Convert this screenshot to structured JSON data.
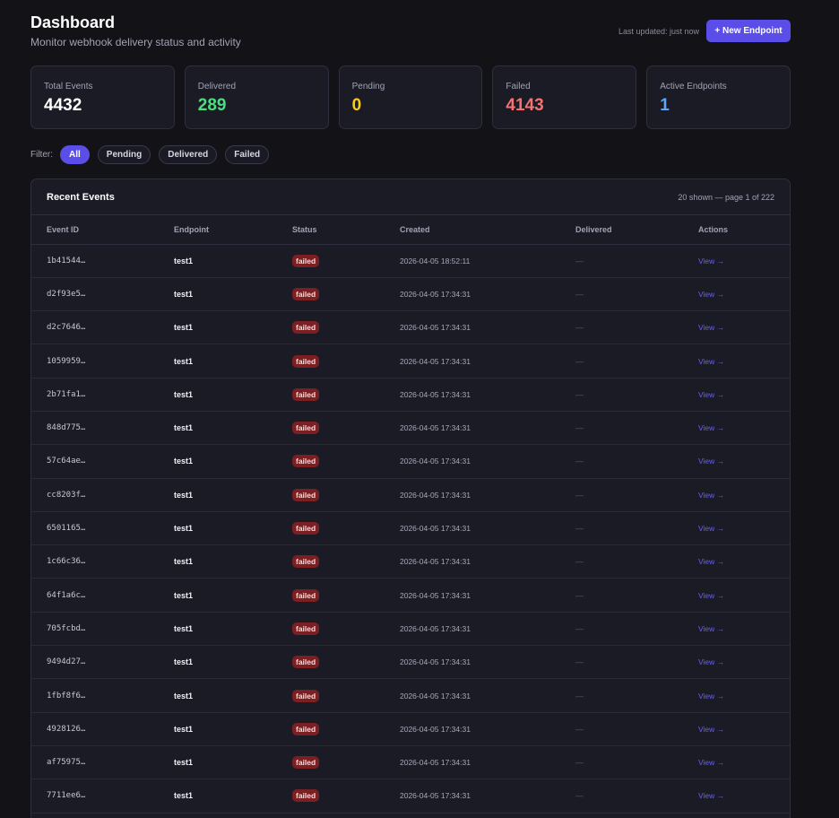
{
  "header": {
    "title": "Dashboard",
    "subtitle": "Monitor webhook delivery status and activity",
    "last_updated": "Last updated: just now",
    "new_endpoint_label": "+ New Endpoint"
  },
  "stats": [
    {
      "label": "Total Events",
      "value": "4432",
      "color": "#ffffff"
    },
    {
      "label": "Delivered",
      "value": "289",
      "color": "#4ade80"
    },
    {
      "label": "Pending",
      "value": "0",
      "color": "#facc15"
    },
    {
      "label": "Failed",
      "value": "4143",
      "color": "#f87171"
    },
    {
      "label": "Active Endpoints",
      "value": "1",
      "color": "#60a5fa"
    }
  ],
  "filters": {
    "label": "Filter:",
    "options": [
      "All",
      "Pending",
      "Delivered",
      "Failed"
    ],
    "active": "All"
  },
  "events": {
    "title": "Recent Events",
    "meta": "20 shown — page 1 of 222",
    "columns": [
      "Event ID",
      "Endpoint",
      "Status",
      "Created",
      "Delivered",
      "Actions"
    ],
    "rows": [
      {
        "id": "1b41544…",
        "endpoint": "test1",
        "status": "failed",
        "created": "2026-04-05 18:52:11",
        "delivered": "—",
        "action": "View →"
      },
      {
        "id": "d2f93e5…",
        "endpoint": "test1",
        "status": "failed",
        "created": "2026-04-05 17:34:31",
        "delivered": "—",
        "action": "View →"
      },
      {
        "id": "d2c7646…",
        "endpoint": "test1",
        "status": "failed",
        "created": "2026-04-05 17:34:31",
        "delivered": "—",
        "action": "View →"
      },
      {
        "id": "1059959…",
        "endpoint": "test1",
        "status": "failed",
        "created": "2026-04-05 17:34:31",
        "delivered": "—",
        "action": "View →"
      },
      {
        "id": "2b71fa1…",
        "endpoint": "test1",
        "status": "failed",
        "created": "2026-04-05 17:34:31",
        "delivered": "—",
        "action": "View →"
      },
      {
        "id": "848d775…",
        "endpoint": "test1",
        "status": "failed",
        "created": "2026-04-05 17:34:31",
        "delivered": "—",
        "action": "View →"
      },
      {
        "id": "57c64ae…",
        "endpoint": "test1",
        "status": "failed",
        "created": "2026-04-05 17:34:31",
        "delivered": "—",
        "action": "View →"
      },
      {
        "id": "cc8203f…",
        "endpoint": "test1",
        "status": "failed",
        "created": "2026-04-05 17:34:31",
        "delivered": "—",
        "action": "View →"
      },
      {
        "id": "6501165…",
        "endpoint": "test1",
        "status": "failed",
        "created": "2026-04-05 17:34:31",
        "delivered": "—",
        "action": "View →"
      },
      {
        "id": "1c66c36…",
        "endpoint": "test1",
        "status": "failed",
        "created": "2026-04-05 17:34:31",
        "delivered": "—",
        "action": "View →"
      },
      {
        "id": "64f1a6c…",
        "endpoint": "test1",
        "status": "failed",
        "created": "2026-04-05 17:34:31",
        "delivered": "—",
        "action": "View →"
      },
      {
        "id": "705fcbd…",
        "endpoint": "test1",
        "status": "failed",
        "created": "2026-04-05 17:34:31",
        "delivered": "—",
        "action": "View →"
      },
      {
        "id": "9494d27…",
        "endpoint": "test1",
        "status": "failed",
        "created": "2026-04-05 17:34:31",
        "delivered": "—",
        "action": "View →"
      },
      {
        "id": "1fbf8f6…",
        "endpoint": "test1",
        "status": "failed",
        "created": "2026-04-05 17:34:31",
        "delivered": "—",
        "action": "View →"
      },
      {
        "id": "4928126…",
        "endpoint": "test1",
        "status": "failed",
        "created": "2026-04-05 17:34:31",
        "delivered": "—",
        "action": "View →"
      },
      {
        "id": "af75975…",
        "endpoint": "test1",
        "status": "failed",
        "created": "2026-04-05 17:34:31",
        "delivered": "—",
        "action": "View →"
      },
      {
        "id": "7711ee6…",
        "endpoint": "test1",
        "status": "failed",
        "created": "2026-04-05 17:34:31",
        "delivered": "—",
        "action": "View →"
      }
    ]
  }
}
